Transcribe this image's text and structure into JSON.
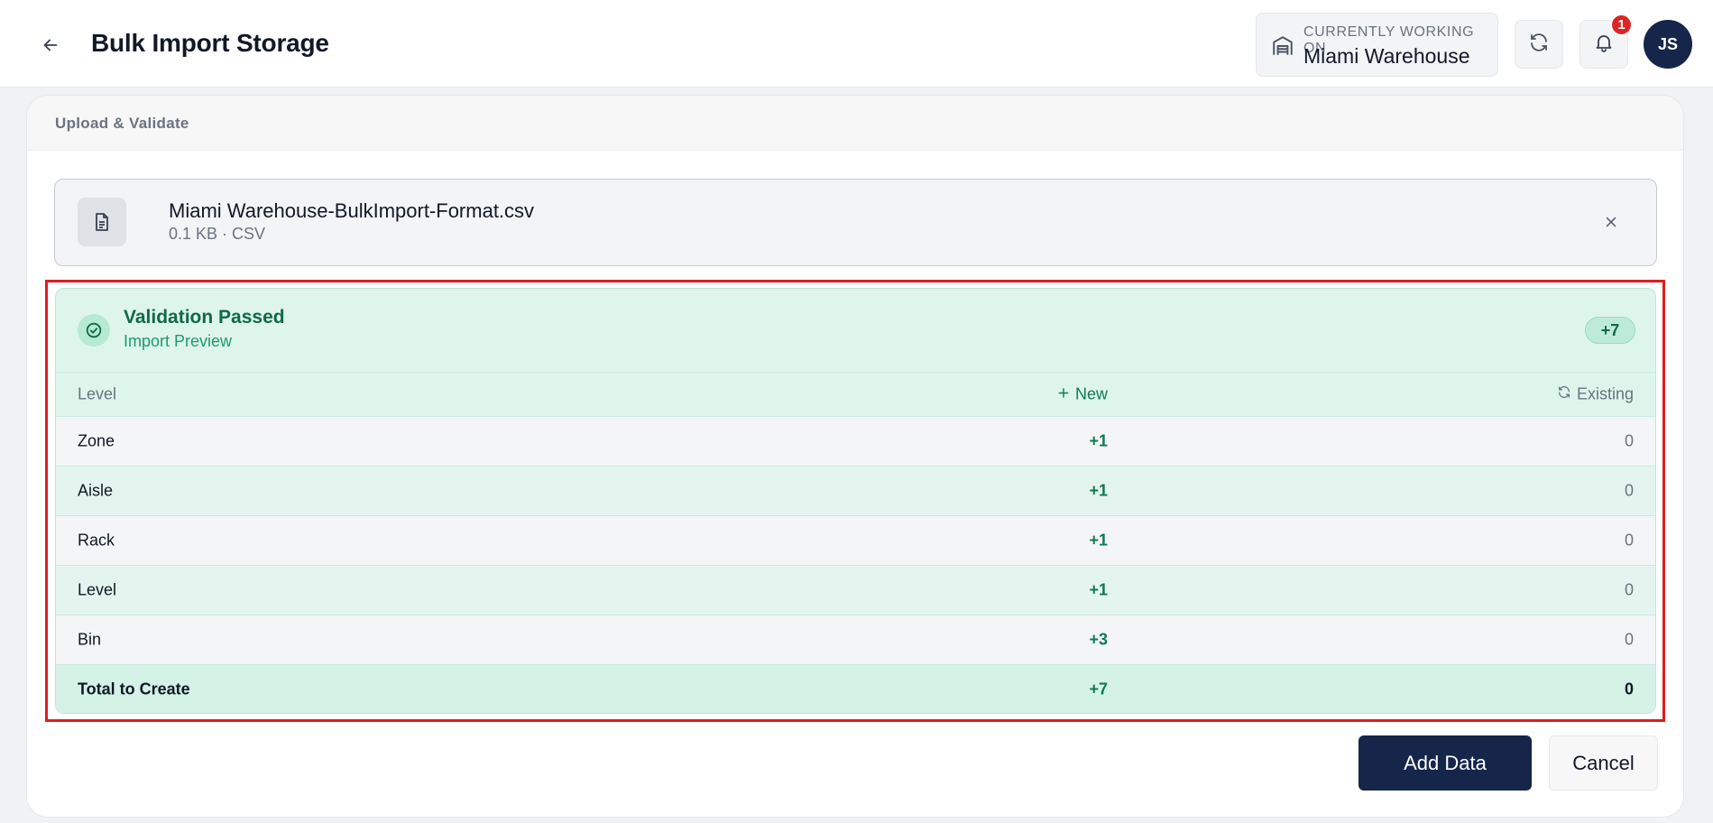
{
  "header": {
    "title": "Bulk Import Storage",
    "workspace_caption": "CURRENTLY WORKING ON",
    "workspace_name": "Miami Warehouse",
    "notification_count": "1",
    "avatar_initials": "JS"
  },
  "section": {
    "label": "Upload & Validate"
  },
  "file": {
    "name": "Miami Warehouse-BulkImport-Format.csv",
    "meta": "0.1 KB · CSV"
  },
  "validation": {
    "title": "Validation Passed",
    "subtitle": "Import Preview",
    "badge": "+7",
    "columns": {
      "level": "Level",
      "new": "New",
      "existing": "Existing"
    },
    "rows": [
      {
        "level": "Zone",
        "new": "+1",
        "existing": "0"
      },
      {
        "level": "Aisle",
        "new": "+1",
        "existing": "0"
      },
      {
        "level": "Rack",
        "new": "+1",
        "existing": "0"
      },
      {
        "level": "Level",
        "new": "+1",
        "existing": "0"
      },
      {
        "level": "Bin",
        "new": "+3",
        "existing": "0"
      }
    ],
    "total": {
      "level": "Total to Create",
      "new": "+7",
      "existing": "0"
    }
  },
  "actions": {
    "add_label": "Add Data",
    "cancel_label": "Cancel"
  },
  "colors": {
    "primary": "#16254a",
    "success": "#0f6a47",
    "highlight": "#e11d1d",
    "badge": "#dc2626"
  }
}
